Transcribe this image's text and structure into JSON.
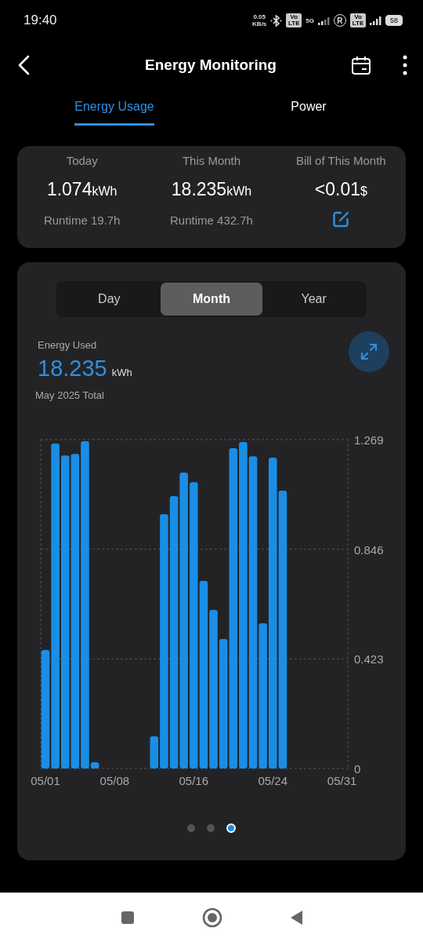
{
  "status_bar": {
    "time": "19:40",
    "net_speed": [
      "0.05",
      "KB/s"
    ],
    "network_label": "5G",
    "volte_badges": [
      "Vo LTE",
      "Vo LTE"
    ],
    "roaming": "R",
    "battery": "58"
  },
  "header": {
    "title": "Energy Monitoring"
  },
  "tabs": [
    {
      "label": "Energy Usage",
      "selected": true
    },
    {
      "label": "Power",
      "selected": false
    }
  ],
  "summary": [
    {
      "label": "Today",
      "value": "1.074",
      "unit": "kWh",
      "kind": "runtime",
      "footer": "Runtime 19.7h"
    },
    {
      "label": "This Month",
      "value": "18.235",
      "unit": "kWh",
      "kind": "runtime",
      "footer": "Runtime 432.7h"
    },
    {
      "label": "Bill of This Month",
      "value": "<0.01",
      "unit": "$",
      "kind": "edit"
    }
  ],
  "period_tabs": [
    {
      "label": "Day",
      "selected": false
    },
    {
      "label": "Month",
      "selected": true
    },
    {
      "label": "Year",
      "selected": false
    }
  ],
  "energy": {
    "label": "Energy Used",
    "value": "18.235",
    "unit": "kWh",
    "caption": "May 2025 Total"
  },
  "chart_data": {
    "type": "bar",
    "categories": [
      "05/01",
      null,
      null,
      null,
      null,
      null,
      null,
      "05/08",
      null,
      null,
      null,
      null,
      null,
      null,
      null,
      "05/16",
      null,
      null,
      null,
      null,
      null,
      null,
      null,
      "05/24",
      null,
      null,
      null,
      null,
      null,
      null,
      "05/31"
    ],
    "series": [
      {
        "color": "#1a8ee6",
        "values": [
          0.457,
          1.254,
          1.208,
          1.214,
          1.263,
          0.024,
          0,
          0,
          0,
          0,
          0,
          0.124,
          0.981,
          1.051,
          1.142,
          1.105,
          0.724,
          0.612,
          0.5,
          1.236,
          1.26,
          1.205,
          0.56,
          1.199,
          1.072,
          null,
          null,
          null,
          null,
          null,
          null
        ]
      }
    ],
    "ylim": [
      0,
      1.269
    ],
    "yticks": [
      0,
      0.423,
      0.846,
      1.269
    ],
    "orientation": "vertical"
  },
  "pager": [
    {
      "selected": false
    },
    {
      "selected": false
    },
    {
      "selected": true
    }
  ]
}
